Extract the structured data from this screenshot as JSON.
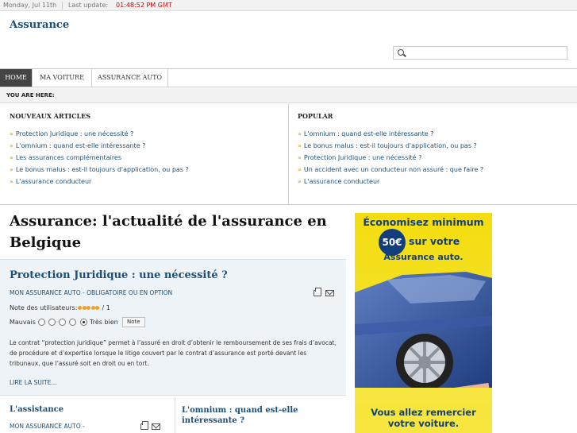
{
  "topbar": {
    "date": "Monday, Jul 11th",
    "update_label": "Last update:",
    "time": "01:48:52 PM GMT"
  },
  "site": {
    "name": "Assurance"
  },
  "search": {
    "value": "",
    "placeholder": ""
  },
  "nav": {
    "items": [
      {
        "label": "HOME",
        "active": true
      },
      {
        "label": "MA VOITURE",
        "active": false
      },
      {
        "label": "ASSURANCE AUTO",
        "active": false
      }
    ]
  },
  "breadcrumb": {
    "label": "YOU ARE HERE:"
  },
  "modules": {
    "latest": {
      "title": "NOUVEAUX ARTICLES",
      "items": [
        "Protection Juridique : une nécessité ?",
        "L'omnium : quand est-elle intéressante ?",
        "Les assurances complémentaires",
        "Le bonus malus : est-il toujours d'application, ou pas ?",
        "L'assurance conducteur"
      ]
    },
    "popular": {
      "title": "POPULAR",
      "items": [
        "L'omnium : quand est-elle intéressante ?",
        "Le bonus malus : est-il toujours d'application, ou pas ?",
        "Protection Juridique : une nécessité ?",
        "Un accident avec un conducteur non assuré : que faire ?",
        "L'assurance conducteur"
      ]
    }
  },
  "main": {
    "title": "Assurance: l'actualité de l'assurance en Belgique"
  },
  "article": {
    "title": "Protection Juridique : une nécessité ?",
    "meta": "MON ASSURANCE AUTO - OBLIGATOIRE OU EN OPTION",
    "rating_label": "Note des utilisateurs:",
    "rating_value": 5,
    "rating_count": "/ 1",
    "vote_low": "Mauvais",
    "vote_high": "Très bien",
    "vote_button": "Note",
    "body": "Le contrat “protection juridique” permet à l’assuré en droit d’obtenir le remboursement de ses frais d’avocat, de procédure et d’expertise lorsque le litige couvert par le contrat d’assurance est porté devant les tribunaux, que l’assuré soit en droit ou en tort.",
    "read_more": "LIRE LA SUITE..."
  },
  "sub_articles": [
    {
      "title": "L'assistance",
      "meta": "MON ASSURANCE AUTO -"
    },
    {
      "title": "L'omnium : quand est-elle intéressante ?"
    }
  ],
  "ad": {
    "line1": "Économisez minimum",
    "price": "50€",
    "line2": "sur votre",
    "line3": "Assurance auto.",
    "line4": "Vous allez remercier",
    "line5": "votre voiture.",
    "color_bg": "#f3dd10",
    "color_text": "#123e7d",
    "color_car": "#2d4f9a"
  },
  "icons": [
    "search-icon",
    "print-icon",
    "email-icon",
    "bullet-icon"
  ]
}
